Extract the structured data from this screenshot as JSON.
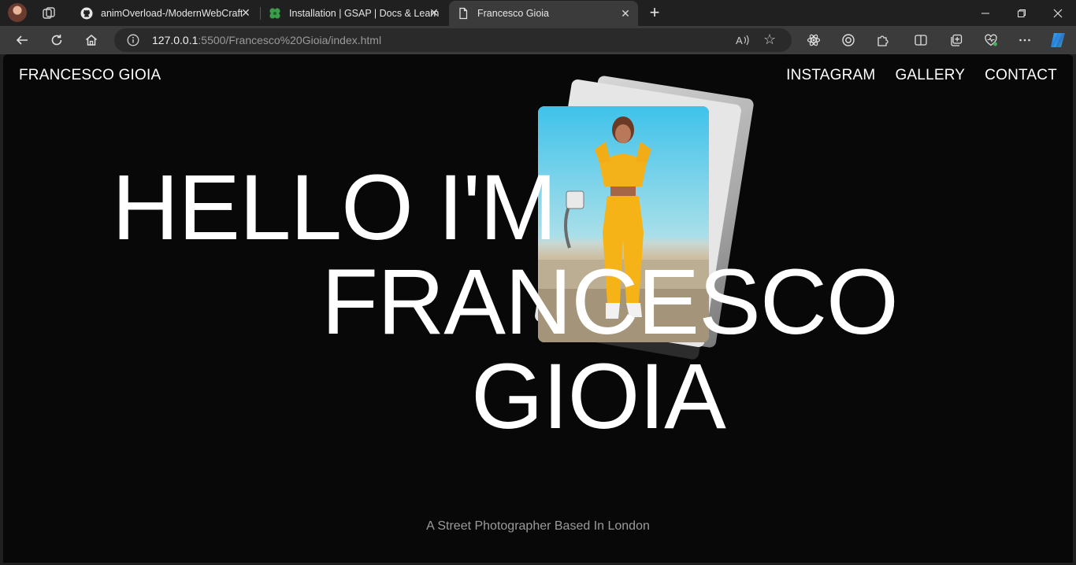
{
  "browser": {
    "tabs": [
      {
        "title": "animOverload-/ModernWebCraft",
        "favicon": "github-icon"
      },
      {
        "title": "Installation | GSAP | Docs & Learn",
        "favicon": "gsap-icon"
      },
      {
        "title": "Francesco Gioia",
        "favicon": "page-icon",
        "active": true
      }
    ],
    "address": {
      "host": "127.0.0.1",
      "path": ":5500/Francesco%20Gioia/index.html"
    }
  },
  "site": {
    "brand": "FRANCESCO GIOIA",
    "nav": [
      "INSTAGRAM",
      "GALLERY",
      "CONTACT"
    ],
    "hero": {
      "line1": "HELLO I'M",
      "line2": "FRANCESCO",
      "line3": "GIOIA"
    },
    "tagline": "A Street Photographer Based In London"
  },
  "colors": {
    "page_bg": "#080808",
    "chrome_bg": "#202020",
    "toolbar_bg": "#3b3b3b",
    "hero_text": "#ffffff",
    "tagline_text": "#9b9b9b"
  }
}
